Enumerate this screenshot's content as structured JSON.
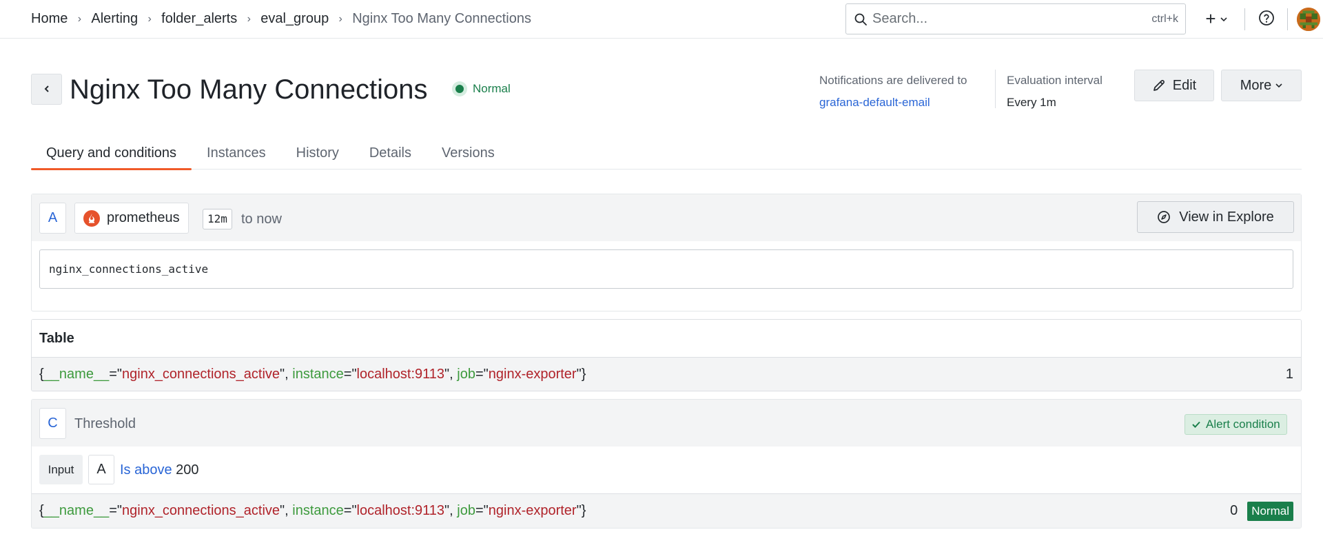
{
  "breadcrumb": {
    "items": [
      "Home",
      "Alerting",
      "folder_alerts",
      "eval_group",
      "Nginx Too Many Connections"
    ],
    "separator": "›"
  },
  "search": {
    "placeholder": "Search...",
    "shortcut": "ctrl+k"
  },
  "topbar": {
    "new_label": "+"
  },
  "rule": {
    "title": "Nginx Too Many Connections",
    "state": "Normal",
    "notifications_label": "Notifications are delivered to",
    "contact_point": "grafana-default-email",
    "eval_interval_label": "Evaluation interval",
    "eval_interval_value": "Every 1m"
  },
  "actions": {
    "edit_label": "Edit",
    "more_label": "More"
  },
  "tabs": [
    {
      "label": "Query and conditions",
      "active": true
    },
    {
      "label": "Instances",
      "active": false
    },
    {
      "label": "History",
      "active": false
    },
    {
      "label": "Details",
      "active": false
    },
    {
      "label": "Versions",
      "active": false
    }
  ],
  "query": {
    "ref_id": "A",
    "datasource": "prometheus",
    "time_from": "12m",
    "time_to": "to now",
    "explore_label": "View in Explore",
    "expr": "nginx_connections_active"
  },
  "table": {
    "title": "Table",
    "series": {
      "name": "nginx_connections_active",
      "instance": "localhost:9113",
      "job": "nginx-exporter"
    },
    "value": "1"
  },
  "threshold": {
    "ref_id": "C",
    "name": "Threshold",
    "alert_condition_label": "Alert condition",
    "input_label": "Input",
    "input_ref": "A",
    "operator": "Is above",
    "threshold_value": "200",
    "result": {
      "name": "nginx_connections_active",
      "instance": "localhost:9113",
      "job": "nginx-exporter"
    },
    "result_value": "0",
    "result_state": "Normal"
  },
  "label_keys": {
    "name_key": "__name__",
    "instance_key": "instance",
    "job_key": "job"
  },
  "colors": {
    "accent": "#f05a28",
    "ok": "#1a7f4b",
    "link": "#2965d6",
    "label_key": "#3d9a3d",
    "label_value": "#b0232a"
  }
}
